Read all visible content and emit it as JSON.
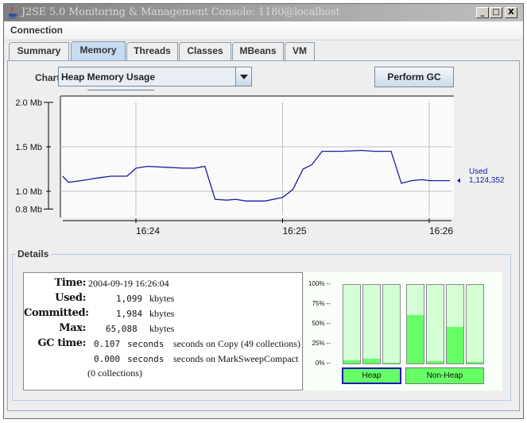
{
  "window": {
    "title": "J2SE 5.0 Monitoring & Management Console: 1180@localhost",
    "controls": [
      "_",
      "□",
      "X"
    ]
  },
  "menubar": {
    "items": [
      "Connection"
    ]
  },
  "tabs": [
    {
      "label": "Summary",
      "active": false
    },
    {
      "label": "Memory",
      "active": true
    },
    {
      "label": "Threads",
      "active": false
    },
    {
      "label": "Classes",
      "active": false
    },
    {
      "label": "MBeans",
      "active": false
    },
    {
      "label": "VM",
      "active": false
    }
  ],
  "chart_selector": {
    "label": "Chart:",
    "selected": "Heap Memory Usage"
  },
  "perform_gc_label": "Perform GC",
  "chart_data": {
    "type": "line",
    "title": "Heap Memory Usage",
    "xlabel": "",
    "ylabel": "",
    "y_unit": "Mb",
    "ylim": [
      0.8,
      2.0
    ],
    "y_ticks": [
      {
        "value": 2.0,
        "label": "2.0 Mb"
      },
      {
        "value": 1.5,
        "label": "1.5 Mb"
      },
      {
        "value": 1.0,
        "label": "1.0 Mb"
      },
      {
        "value": 0.8,
        "label": "0.8 Mb"
      }
    ],
    "x_unit": "minutes after 16:24",
    "xlim": [
      -0.5,
      2.15
    ],
    "x_ticks": [
      {
        "value": 0,
        "label": "16:24"
      },
      {
        "value": 1,
        "label": "16:25"
      },
      {
        "value": 2,
        "label": "16:26"
      }
    ],
    "grid": true,
    "series": [
      {
        "name": "Used",
        "color": "#1a1aa0",
        "x": [
          -0.5,
          -0.46,
          -0.33,
          -0.26,
          -0.17,
          -0.06,
          0.0,
          0.08,
          0.21,
          0.32,
          0.4,
          0.47,
          0.54,
          0.62,
          0.68,
          0.75,
          0.84,
          0.88,
          1.0,
          1.07,
          1.14,
          1.2,
          1.27,
          1.4,
          1.54,
          1.62,
          1.74,
          1.81,
          1.88,
          1.95,
          2.0,
          2.14
        ],
        "values": [
          1.17,
          1.1,
          1.13,
          1.15,
          1.17,
          1.17,
          1.26,
          1.28,
          1.27,
          1.26,
          1.26,
          1.28,
          0.91,
          0.9,
          0.91,
          0.89,
          0.89,
          0.89,
          0.93,
          1.02,
          1.25,
          1.3,
          1.45,
          1.45,
          1.46,
          1.45,
          1.45,
          1.09,
          1.12,
          1.13,
          1.12,
          1.12
        ]
      }
    ],
    "legend": {
      "placement": "right",
      "name": "Used",
      "value": "1,124,352"
    }
  },
  "details": {
    "title": "Details",
    "rows": [
      {
        "label": "Time:",
        "value": "2004-09-19 16:26:04"
      },
      {
        "label": "Used:",
        "value_num": "1,099",
        "value_unit": "kbytes"
      },
      {
        "label": "Committed:",
        "value_num": "1,984",
        "value_unit": "kbytes"
      },
      {
        "label": "Max:",
        "value_num": "65,088",
        "value_unit": "kbytes"
      }
    ],
    "gc": {
      "label": "GC time:",
      "lines": [
        {
          "num": "0.107",
          "unit": "seconds",
          "text": "seconds on Copy (49 collections)"
        },
        {
          "num": "0.000",
          "unit": "seconds",
          "text": "seconds on MarkSweepCompact"
        }
      ],
      "tail": "(0 collections)"
    }
  },
  "memory_pools": {
    "scale_labels": [
      "100% --",
      "75% --",
      "50% --",
      "25% --",
      "0% --"
    ],
    "heap": {
      "label": "Heap",
      "selected": true,
      "fill_percent": [
        4,
        6,
        1
      ]
    },
    "non_heap": {
      "label": "Non-Heap",
      "selected": false,
      "fill_percent": [
        62,
        3,
        46,
        2
      ]
    },
    "colors": {
      "fill": "#66ff66",
      "empty": "#d4ffd4"
    }
  }
}
